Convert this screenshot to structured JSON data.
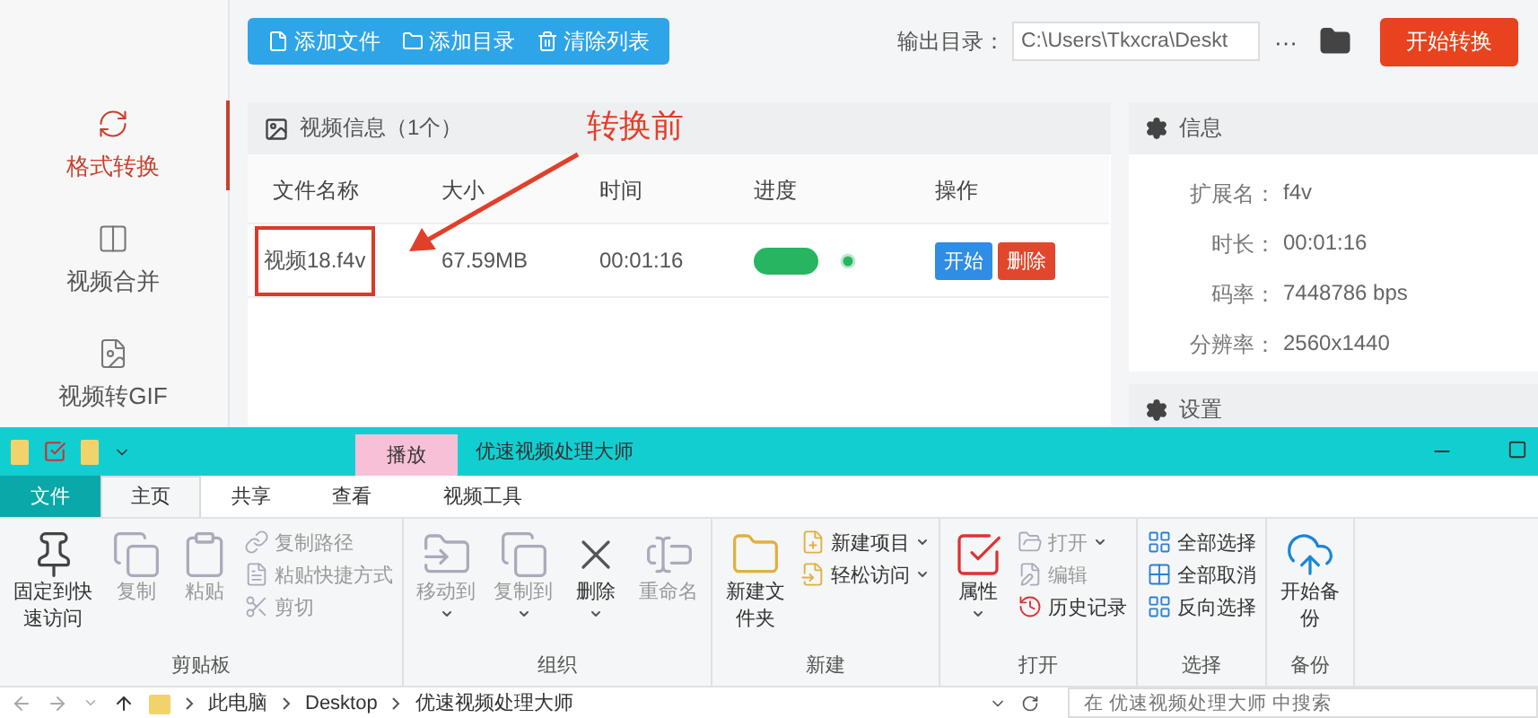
{
  "sidebar": {
    "items": [
      {
        "kind": "convert",
        "label": "格式转换",
        "selected": true
      },
      {
        "kind": "merge",
        "label": "视频合并",
        "selected": false
      },
      {
        "kind": "gif",
        "label": "视频转GIF",
        "selected": false
      }
    ]
  },
  "toolbar": {
    "buttons": [
      {
        "kind": "file",
        "label": "添加文件"
      },
      {
        "kind": "folder",
        "label": "添加目录"
      },
      {
        "kind": "clear",
        "label": "清除列表"
      }
    ],
    "output_label": "输出目录：",
    "output_path": "C:\\Users\\Tkxcra\\Deskt",
    "more": "···",
    "start_button": "开始转换"
  },
  "video_panel": {
    "title": "视频信息（1个）",
    "columns": [
      "文件名称",
      "大小",
      "时间",
      "进度",
      "操作"
    ],
    "rows": [
      {
        "name": "视频18.f4v",
        "highlighted": true,
        "size": "67.59MB",
        "time": "00:01:16",
        "progress": {
          "level": 1
        },
        "actions": [
          {
            "kind": "start",
            "label": "开始"
          },
          {
            "kind": "delete",
            "label": "删除"
          }
        ]
      }
    ]
  },
  "annotation": {
    "label": "转换前"
  },
  "info_panel": {
    "title": "信息",
    "fields": [
      {
        "label": "扩展名：",
        "value": "f4v"
      },
      {
        "label": "时长：",
        "value": "00:01:16"
      },
      {
        "label": "码率：",
        "value": "7448786 bps"
      },
      {
        "label": "分辨率：",
        "value": "2560x1440"
      }
    ]
  },
  "settings_panel": {
    "title": "设置"
  },
  "explorer": {
    "context_tab": "播放",
    "title": "优速视频处理大师",
    "tabs": [
      {
        "kind": "file",
        "label": "文件",
        "selected": false
      },
      {
        "kind": "normal",
        "label": "主页",
        "selected": true
      },
      {
        "kind": "normal",
        "label": "共享",
        "selected": false
      },
      {
        "kind": "normal",
        "label": "查看",
        "selected": false
      },
      {
        "kind": "normal",
        "label": "视频工具",
        "selected": false
      }
    ],
    "groups": [
      {
        "label": "剪贴板",
        "items": [
          {
            "kind": "large",
            "label": "固定到快速访问",
            "disabled": false,
            "dropdown": false
          },
          {
            "kind": "large",
            "label": "复制",
            "disabled": true,
            "dropdown": false
          },
          {
            "kind": "large",
            "label": "粘贴",
            "disabled": true,
            "dropdown": false
          },
          {
            "kind": "small",
            "label": "复制路径",
            "disabled": true,
            "dropdown": false
          },
          {
            "kind": "small",
            "label": "粘贴快捷方式",
            "disabled": true,
            "dropdown": false
          },
          {
            "kind": "small",
            "label": "剪切",
            "disabled": true,
            "dropdown": false
          }
        ]
      },
      {
        "label": "组织",
        "items": [
          {
            "kind": "large",
            "label": "移动到",
            "disabled": true,
            "dropdown": true
          },
          {
            "kind": "large",
            "label": "复制到",
            "disabled": true,
            "dropdown": true
          },
          {
            "kind": "large",
            "label": "删除",
            "disabled": false,
            "dropdown": true
          },
          {
            "kind": "large",
            "label": "重命名",
            "disabled": true,
            "dropdown": false
          }
        ]
      },
      {
        "label": "新建",
        "items": [
          {
            "kind": "large",
            "label": "新建文件夹",
            "disabled": false,
            "dropdown": false
          },
          {
            "kind": "small",
            "label": "新建项目",
            "disabled": false,
            "dropdown": true
          },
          {
            "kind": "small",
            "label": "轻松访问",
            "disabled": false,
            "dropdown": true
          }
        ]
      },
      {
        "label": "打开",
        "items": [
          {
            "kind": "large",
            "label": "属性",
            "disabled": false,
            "dropdown": true
          },
          {
            "kind": "small",
            "label": "打开",
            "disabled": true,
            "dropdown": true
          },
          {
            "kind": "small",
            "label": "编辑",
            "disabled": true,
            "dropdown": false
          },
          {
            "kind": "small",
            "label": "历史记录",
            "disabled": false,
            "dropdown": false
          }
        ]
      },
      {
        "label": "选择",
        "items": [
          {
            "kind": "small",
            "label": "全部选择",
            "disabled": false,
            "dropdown": false
          },
          {
            "kind": "small",
            "label": "全部取消",
            "disabled": false,
            "dropdown": false
          },
          {
            "kind": "small",
            "label": "反向选择",
            "disabled": false,
            "dropdown": false
          }
        ]
      },
      {
        "label": "备份",
        "items": [
          {
            "kind": "large",
            "label": "开始备份",
            "disabled": false,
            "dropdown": false
          }
        ]
      }
    ],
    "address": {
      "path": [
        "此电脑",
        "Desktop",
        "优速视频处理大师"
      ]
    },
    "search": {
      "placeholder": "在 优速视频处理大师 中搜索"
    }
  }
}
